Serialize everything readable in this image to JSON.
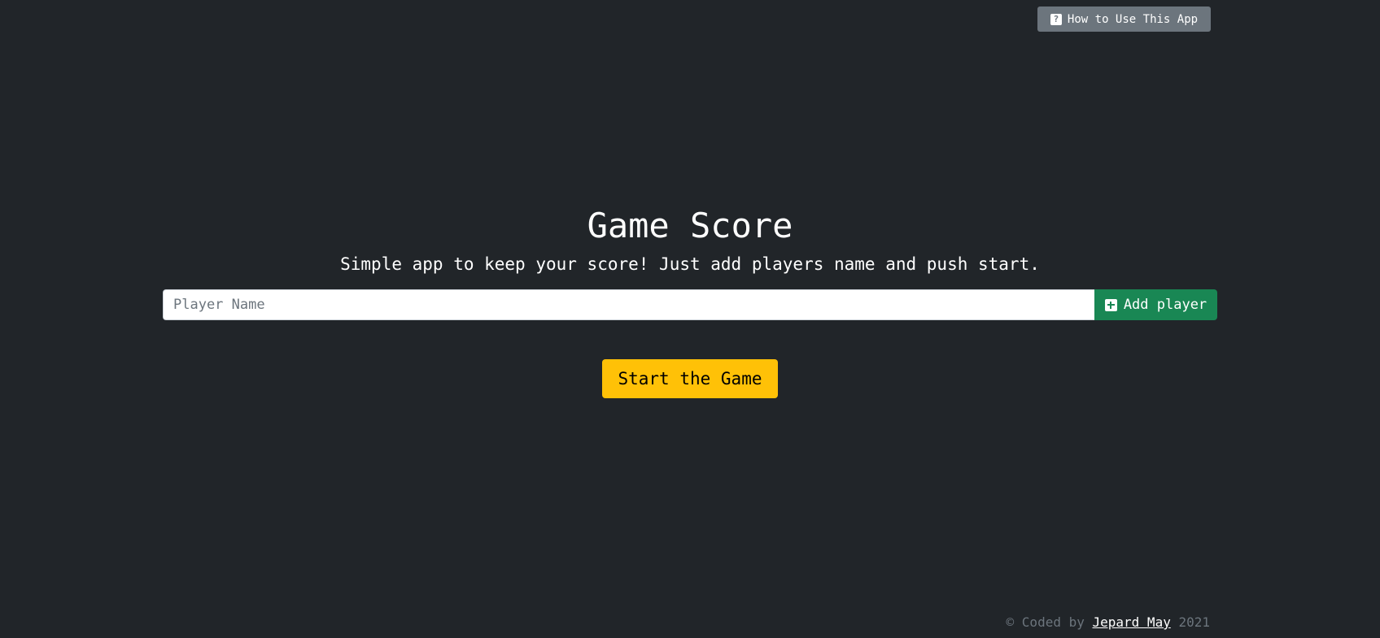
{
  "header": {
    "help_button_label": "How to Use This App",
    "help_icon": "question-square-icon"
  },
  "main": {
    "title": "Game Score",
    "subtitle": "Simple app to keep your score! Just add players name and push start.",
    "player_input": {
      "placeholder": "Player Name",
      "value": ""
    },
    "add_button_label": "Add player",
    "add_icon": "plus-square-icon",
    "start_button_label": "Start the Game"
  },
  "footer": {
    "prefix": "© Coded by",
    "author": "Jepard May",
    "year": "2021"
  },
  "colors": {
    "background": "#212529",
    "help_button": "#6c757d",
    "add_button": "#198754",
    "start_button": "#ffc107"
  }
}
